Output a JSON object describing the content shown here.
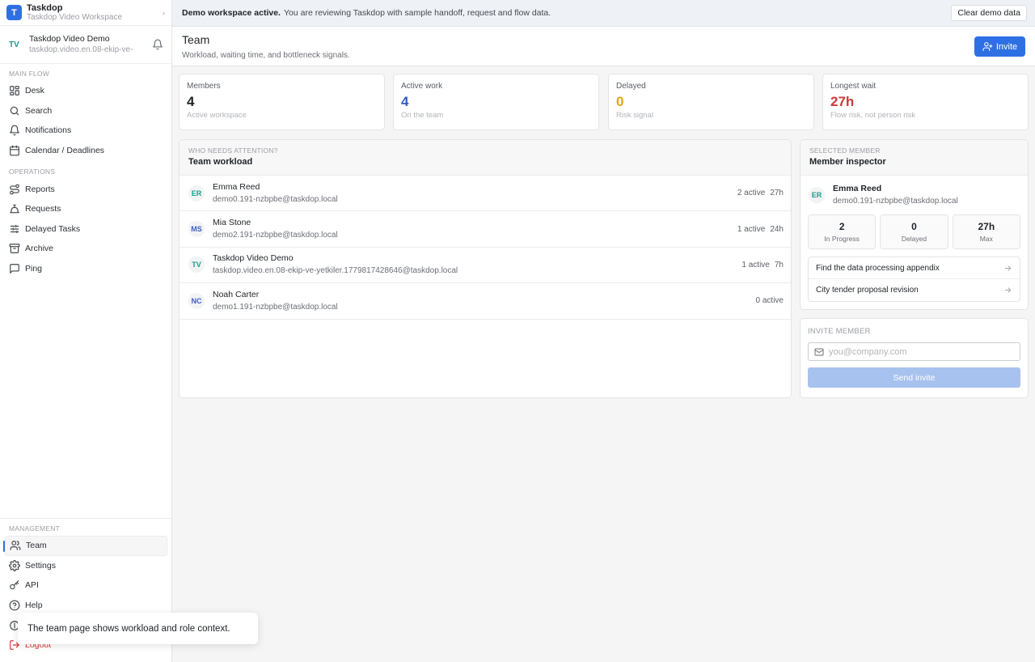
{
  "brand": {
    "logo_letter": "T",
    "name": "Taskdop",
    "subtitle": "Taskdop Video Workspace"
  },
  "workspace": {
    "avatar": "TV",
    "name": "Taskdop Video Demo",
    "email": "taskdop.video.en.08-ekip-ve-"
  },
  "sidebar": {
    "main_flow_label": "Main flow",
    "main_flow": [
      {
        "label": "Desk",
        "icon": "grid-icon"
      },
      {
        "label": "Search",
        "icon": "search-icon"
      },
      {
        "label": "Notifications",
        "icon": "bell-icon"
      },
      {
        "label": "Calendar / Deadlines",
        "icon": "calendar-icon"
      }
    ],
    "operations_label": "Operations",
    "operations": [
      {
        "label": "Reports",
        "icon": "route-icon"
      },
      {
        "label": "Requests",
        "icon": "concierge-bell-icon"
      },
      {
        "label": "Delayed Tasks",
        "icon": "sliders-icon"
      },
      {
        "label": "Archive",
        "icon": "archive-icon"
      },
      {
        "label": "Ping",
        "icon": "message-square-icon"
      }
    ],
    "management_label": "Management",
    "management": [
      {
        "label": "Team",
        "icon": "users-icon"
      },
      {
        "label": "Settings",
        "icon": "gear-icon"
      },
      {
        "label": "API",
        "icon": "key-icon"
      },
      {
        "label": "Help",
        "icon": "help-circle-icon"
      }
    ],
    "logout_label": "Logout"
  },
  "toast": {
    "text": "The team page shows workload and role context."
  },
  "banner": {
    "bold": "Demo workspace active.",
    "text": "You are reviewing Taskdop with sample handoff, request and flow data.",
    "button": "Clear demo data"
  },
  "header": {
    "title": "Team",
    "subtitle": "Workload, waiting time, and bottleneck signals.",
    "invite_label": "Invite"
  },
  "stats": [
    {
      "label": "Members",
      "value": "4",
      "note": "Active workspace",
      "color": "#1f2328"
    },
    {
      "label": "Active work",
      "value": "4",
      "note": "On the team",
      "color": "#2f5cc4"
    },
    {
      "label": "Delayed",
      "value": "0",
      "note": "Risk signal",
      "color": "#e0a21b"
    },
    {
      "label": "Longest wait",
      "value": "27h",
      "note": "Flow risk, not person risk",
      "color": "#d0383a"
    }
  ],
  "workload": {
    "kicker": "Who needs attention?",
    "title": "Team workload",
    "members": [
      {
        "initials": "ER",
        "initials_color": "#1a9d8a",
        "name": "Emma Reed",
        "email": "demo0.191-nzbpbe@taskdop.local",
        "active": "2 active",
        "wait": "27h"
      },
      {
        "initials": "MS",
        "initials_color": "#3d5fc2",
        "name": "Mia Stone",
        "email": "demo2.191-nzbpbe@taskdop.local",
        "active": "1 active",
        "wait": "24h"
      },
      {
        "initials": "TV",
        "initials_color": "#1a9d8a",
        "name": "Taskdop Video Demo",
        "email": "taskdop.video.en.08-ekip-ve-yetkiler.1779817428646@taskdop.local",
        "active": "1 active",
        "wait": "7h"
      },
      {
        "initials": "NC",
        "initials_color": "#3d5fc2",
        "name": "Noah Carter",
        "email": "demo1.191-nzbpbe@taskdop.local",
        "active": "0 active",
        "wait": ""
      }
    ]
  },
  "inspector": {
    "kicker": "Selected member",
    "title": "Member inspector",
    "member": {
      "initials": "ER",
      "name": "Emma Reed",
      "email": "demo0.191-nzbpbe@taskdop.local"
    },
    "metrics": [
      {
        "value": "2",
        "label": "In Progress"
      },
      {
        "value": "0",
        "label": "Delayed"
      },
      {
        "value": "27h",
        "label": "Max"
      }
    ],
    "tasks": [
      "Find the data processing appendix",
      "City tender proposal revision"
    ]
  },
  "invite_form": {
    "kicker": "Invite member",
    "placeholder": "you@company.com",
    "button": "Send invite"
  }
}
